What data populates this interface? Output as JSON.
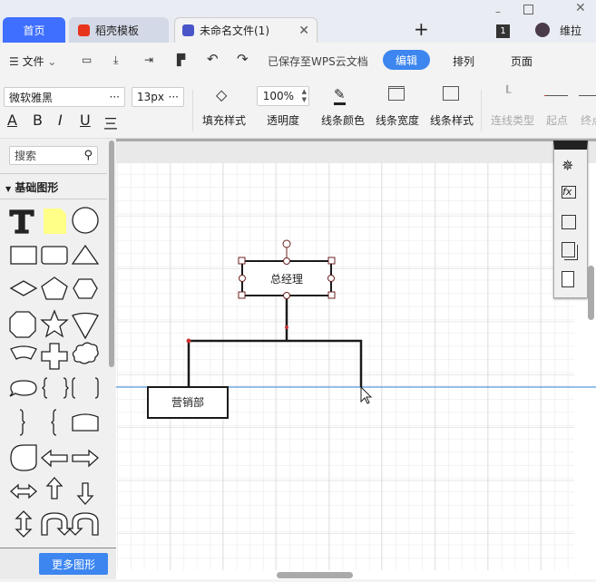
{
  "tabs": {
    "home": "首页",
    "templates": "稻壳模板",
    "file": "未命名文件(1)",
    "new_tab": "+"
  },
  "window": {
    "user": "维拉",
    "badge": "1"
  },
  "toolbar": {
    "file_menu": "文件",
    "save_status": "已保存至WPS云文档",
    "edit": "编辑",
    "arrange": "排列",
    "page": "页面"
  },
  "format": {
    "font": "微软雅黑",
    "font_size": "13px",
    "opacity": "100%",
    "fill_style": "填充样式",
    "opacity_label": "透明度",
    "line_color": "线条颜色",
    "line_width": "线条宽度",
    "line_style": "线条样式",
    "connector_type": "连线类型",
    "start": "起点",
    "end": "终点",
    "ellipsis": "···"
  },
  "sidebar": {
    "search_placeholder": "搜索",
    "section": "基础图形",
    "more_shapes": "更多图形"
  },
  "diagram": {
    "nodes": [
      {
        "label": "总经理"
      },
      {
        "label": "营销部"
      }
    ]
  },
  "colors": {
    "accent": "#3d86f0",
    "home_tab": "#3f6fff",
    "guide": "#2f7fd8",
    "selection": "#6b2020"
  }
}
